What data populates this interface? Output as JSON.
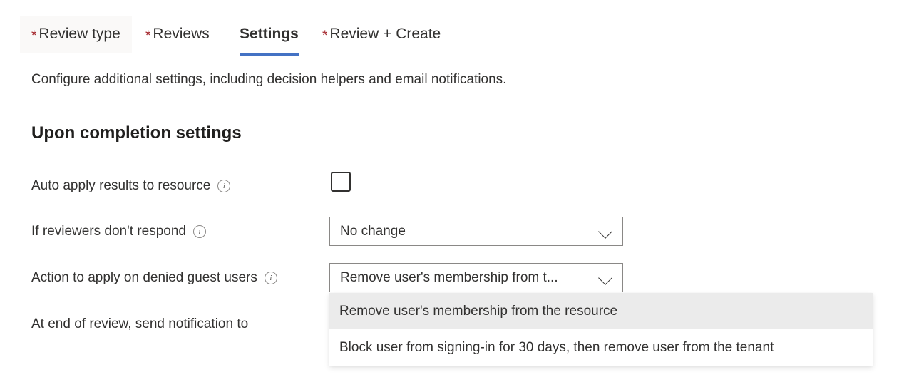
{
  "tabs": [
    {
      "label": "Review type",
      "required": true,
      "active": false,
      "hovered": true
    },
    {
      "label": "Reviews",
      "required": true,
      "active": false,
      "hovered": false
    },
    {
      "label": "Settings",
      "required": false,
      "active": true,
      "hovered": false
    },
    {
      "label": "Review + Create",
      "required": true,
      "active": false,
      "hovered": false
    }
  ],
  "required_marker": "*",
  "description": "Configure additional settings, including decision helpers and email notifications.",
  "section": {
    "heading": "Upon completion settings"
  },
  "rows": {
    "auto_apply": {
      "label": "Auto apply results to resource",
      "info_icon": "info-icon",
      "info_glyph": "i",
      "checkbox_checked": false
    },
    "no_respond": {
      "label": "If reviewers don't respond",
      "info_icon": "info-icon",
      "info_glyph": "i",
      "value": "No change",
      "chevron_icon": "chevron-down-icon"
    },
    "denied_guest": {
      "label": "Action to apply on denied guest users",
      "info_icon": "info-icon",
      "info_glyph": "i",
      "value": "Remove user's membership from t...",
      "chevron_icon": "chevron-down-icon",
      "options": [
        {
          "label": "Remove user's membership from the resource",
          "selected": true
        },
        {
          "label": "Block user from signing-in for 30 days, then remove user from the tenant",
          "selected": false
        }
      ]
    },
    "notify": {
      "label": "At end of review, send notification to"
    }
  },
  "colors": {
    "accent": "#4472c4",
    "required": "#a4262c",
    "text": "#323130",
    "border": "#8a8886",
    "option_highlight": "#ebebeb",
    "tab_hover": "#faf9f8"
  }
}
